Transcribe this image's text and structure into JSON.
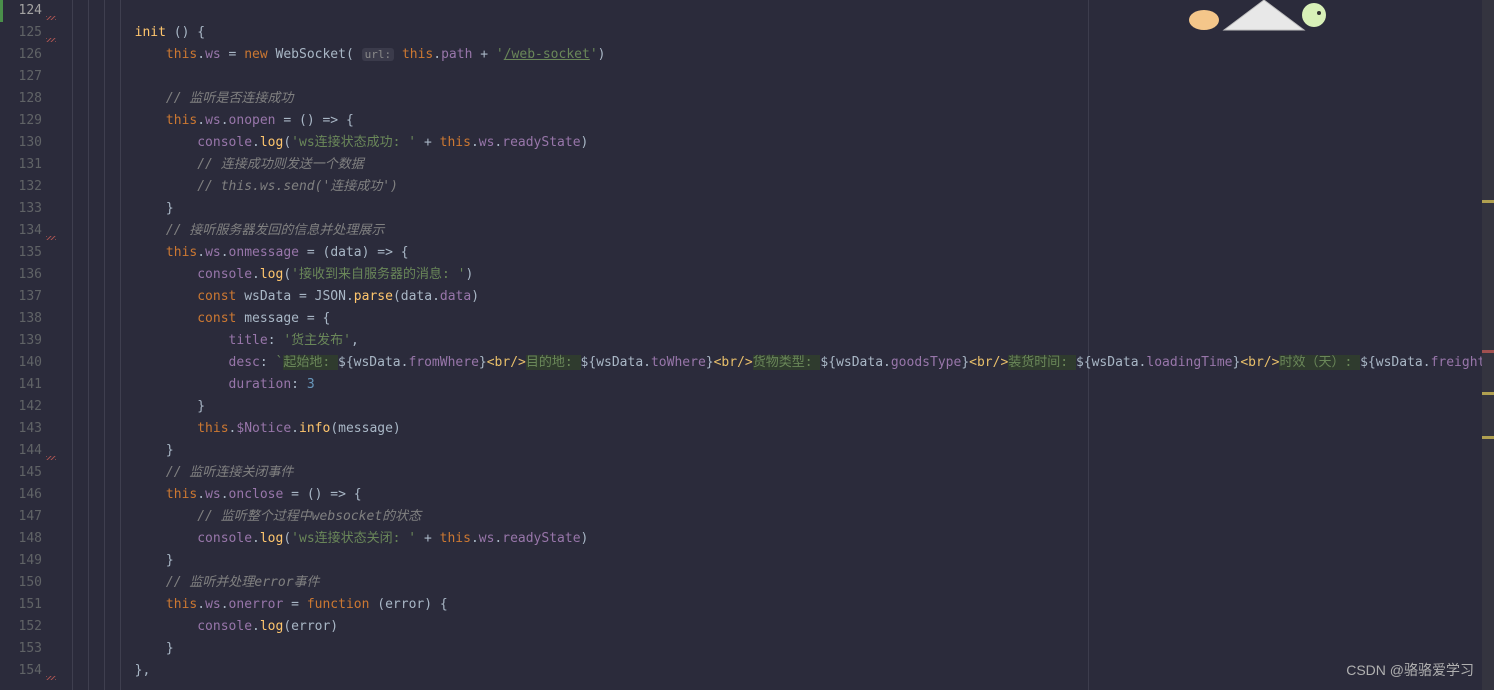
{
  "watermark": "CSDN @骆骆爱学习",
  "lines": [
    {
      "num": 124,
      "indent": 2,
      "tokens": []
    },
    {
      "num": 125,
      "indent": 2,
      "tokens": [
        {
          "t": "method",
          "v": "init"
        },
        {
          "t": "punc",
          "v": " () {"
        }
      ]
    },
    {
      "num": 126,
      "indent": 3,
      "tokens": [
        {
          "t": "keyword",
          "v": "this"
        },
        {
          "t": "punc",
          "v": "."
        },
        {
          "t": "prop",
          "v": "ws"
        },
        {
          "t": "punc",
          "v": " = "
        },
        {
          "t": "keyword",
          "v": "new"
        },
        {
          "t": "punc",
          "v": " "
        },
        {
          "t": "type",
          "v": "WebSocket"
        },
        {
          "t": "punc",
          "v": "( "
        },
        {
          "t": "hint",
          "v": "url:"
        },
        {
          "t": "punc",
          "v": " "
        },
        {
          "t": "keyword",
          "v": "this"
        },
        {
          "t": "punc",
          "v": "."
        },
        {
          "t": "prop",
          "v": "path"
        },
        {
          "t": "punc",
          "v": " + "
        },
        {
          "t": "string",
          "v": "'"
        },
        {
          "t": "stringlink",
          "v": "/web-socket"
        },
        {
          "t": "string",
          "v": "'"
        },
        {
          "t": "punc",
          "v": ")"
        }
      ]
    },
    {
      "num": 127,
      "indent": 3,
      "tokens": []
    },
    {
      "num": 128,
      "indent": 3,
      "tokens": [
        {
          "t": "comment",
          "v": "// 监听是否连接成功"
        }
      ]
    },
    {
      "num": 129,
      "indent": 3,
      "tokens": [
        {
          "t": "keyword",
          "v": "this"
        },
        {
          "t": "punc",
          "v": "."
        },
        {
          "t": "prop",
          "v": "ws"
        },
        {
          "t": "punc",
          "v": "."
        },
        {
          "t": "prop",
          "v": "onopen"
        },
        {
          "t": "punc",
          "v": " = () => {"
        }
      ]
    },
    {
      "num": 130,
      "indent": 4,
      "tokens": [
        {
          "t": "field",
          "v": "console"
        },
        {
          "t": "punc",
          "v": "."
        },
        {
          "t": "method",
          "v": "log"
        },
        {
          "t": "punc",
          "v": "("
        },
        {
          "t": "string",
          "v": "'ws连接状态成功: '"
        },
        {
          "t": "punc",
          "v": " + "
        },
        {
          "t": "keyword",
          "v": "this"
        },
        {
          "t": "punc",
          "v": "."
        },
        {
          "t": "prop",
          "v": "ws"
        },
        {
          "t": "punc",
          "v": "."
        },
        {
          "t": "prop",
          "v": "readyState"
        },
        {
          "t": "punc",
          "v": ")"
        }
      ]
    },
    {
      "num": 131,
      "indent": 4,
      "tokens": [
        {
          "t": "comment",
          "v": "// 连接成功则发送一个数据"
        }
      ]
    },
    {
      "num": 132,
      "indent": 4,
      "tokens": [
        {
          "t": "comment",
          "v": "// this.ws.send('连接成功')"
        }
      ]
    },
    {
      "num": 133,
      "indent": 3,
      "tokens": [
        {
          "t": "punc",
          "v": "}"
        }
      ]
    },
    {
      "num": 134,
      "indent": 3,
      "tokens": [
        {
          "t": "comment",
          "v": "// 接听服务器发回的信息并处理展示"
        }
      ]
    },
    {
      "num": 135,
      "indent": 3,
      "tokens": [
        {
          "t": "keyword",
          "v": "this"
        },
        {
          "t": "punc",
          "v": "."
        },
        {
          "t": "prop",
          "v": "ws"
        },
        {
          "t": "punc",
          "v": "."
        },
        {
          "t": "prop",
          "v": "onmessage"
        },
        {
          "t": "punc",
          "v": " = ("
        },
        {
          "t": "param",
          "v": "data"
        },
        {
          "t": "punc",
          "v": ") => {"
        }
      ]
    },
    {
      "num": 136,
      "indent": 4,
      "tokens": [
        {
          "t": "field",
          "v": "console"
        },
        {
          "t": "punc",
          "v": "."
        },
        {
          "t": "method",
          "v": "log"
        },
        {
          "t": "punc",
          "v": "("
        },
        {
          "t": "string",
          "v": "'接收到来自服务器的消息: '"
        },
        {
          "t": "punc",
          "v": ")"
        }
      ]
    },
    {
      "num": 137,
      "indent": 4,
      "tokens": [
        {
          "t": "keyword",
          "v": "const"
        },
        {
          "t": "punc",
          "v": " wsData = "
        },
        {
          "t": "type",
          "v": "JSON"
        },
        {
          "t": "punc",
          "v": "."
        },
        {
          "t": "method",
          "v": "parse"
        },
        {
          "t": "punc",
          "v": "(data."
        },
        {
          "t": "prop",
          "v": "data"
        },
        {
          "t": "punc",
          "v": ")"
        }
      ]
    },
    {
      "num": 138,
      "indent": 4,
      "tokens": [
        {
          "t": "keyword",
          "v": "const"
        },
        {
          "t": "punc",
          "v": " message = {"
        }
      ]
    },
    {
      "num": 139,
      "indent": 5,
      "tokens": [
        {
          "t": "prop",
          "v": "title"
        },
        {
          "t": "punc",
          "v": ": "
        },
        {
          "t": "string",
          "v": "'货主发布'"
        },
        {
          "t": "punc",
          "v": ","
        }
      ]
    },
    {
      "num": 140,
      "indent": 5,
      "desc": true
    },
    {
      "num": 141,
      "indent": 5,
      "tokens": [
        {
          "t": "prop",
          "v": "duration"
        },
        {
          "t": "punc",
          "v": ": "
        },
        {
          "t": "num",
          "v": "3"
        }
      ]
    },
    {
      "num": 142,
      "indent": 4,
      "tokens": [
        {
          "t": "punc",
          "v": "}"
        }
      ]
    },
    {
      "num": 143,
      "indent": 4,
      "tokens": [
        {
          "t": "keyword",
          "v": "this"
        },
        {
          "t": "punc",
          "v": "."
        },
        {
          "t": "prop",
          "v": "$Notice"
        },
        {
          "t": "punc",
          "v": "."
        },
        {
          "t": "method",
          "v": "info"
        },
        {
          "t": "punc",
          "v": "(message)"
        }
      ]
    },
    {
      "num": 144,
      "indent": 3,
      "tokens": [
        {
          "t": "punc",
          "v": "}"
        }
      ]
    },
    {
      "num": 145,
      "indent": 3,
      "tokens": [
        {
          "t": "comment",
          "v": "// 监听连接关闭事件"
        }
      ]
    },
    {
      "num": 146,
      "indent": 3,
      "tokens": [
        {
          "t": "keyword",
          "v": "this"
        },
        {
          "t": "punc",
          "v": "."
        },
        {
          "t": "prop",
          "v": "ws"
        },
        {
          "t": "punc",
          "v": "."
        },
        {
          "t": "prop",
          "v": "onclose"
        },
        {
          "t": "punc",
          "v": " = () => {"
        }
      ]
    },
    {
      "num": 147,
      "indent": 4,
      "tokens": [
        {
          "t": "comment",
          "v": "// 监听整个过程中websocket的状态"
        }
      ]
    },
    {
      "num": 148,
      "indent": 4,
      "tokens": [
        {
          "t": "field",
          "v": "console"
        },
        {
          "t": "punc",
          "v": "."
        },
        {
          "t": "method",
          "v": "log"
        },
        {
          "t": "punc",
          "v": "("
        },
        {
          "t": "string",
          "v": "'ws连接状态关闭: '"
        },
        {
          "t": "punc",
          "v": " + "
        },
        {
          "t": "keyword",
          "v": "this"
        },
        {
          "t": "punc",
          "v": "."
        },
        {
          "t": "prop",
          "v": "ws"
        },
        {
          "t": "punc",
          "v": "."
        },
        {
          "t": "prop",
          "v": "readyState"
        },
        {
          "t": "punc",
          "v": ")"
        }
      ]
    },
    {
      "num": 149,
      "indent": 3,
      "tokens": [
        {
          "t": "punc",
          "v": "}"
        }
      ]
    },
    {
      "num": 150,
      "indent": 3,
      "tokens": [
        {
          "t": "comment",
          "v": "// 监听并处理error事件"
        }
      ]
    },
    {
      "num": 151,
      "indent": 3,
      "tokens": [
        {
          "t": "keyword",
          "v": "this"
        },
        {
          "t": "punc",
          "v": "."
        },
        {
          "t": "prop",
          "v": "ws"
        },
        {
          "t": "punc",
          "v": "."
        },
        {
          "t": "prop",
          "v": "onerror"
        },
        {
          "t": "punc",
          "v": " = "
        },
        {
          "t": "keyword",
          "v": "function"
        },
        {
          "t": "punc",
          "v": " ("
        },
        {
          "t": "param",
          "v": "error"
        },
        {
          "t": "punc",
          "v": ") {"
        }
      ]
    },
    {
      "num": 152,
      "indent": 4,
      "tokens": [
        {
          "t": "field",
          "v": "console"
        },
        {
          "t": "punc",
          "v": "."
        },
        {
          "t": "method",
          "v": "log"
        },
        {
          "t": "punc",
          "v": "(error)"
        }
      ]
    },
    {
      "num": 153,
      "indent": 3,
      "tokens": [
        {
          "t": "punc",
          "v": "}"
        }
      ]
    },
    {
      "num": 154,
      "indent": 2,
      "tokens": [
        {
          "t": "punc",
          "v": "},"
        }
      ]
    }
  ],
  "desc_line": {
    "prefix_prop": "desc",
    "segments": [
      {
        "label": "起始地: ",
        "expr": "wsData.fromWhere",
        "field": "fromWhere"
      },
      {
        "label": "目的地: ",
        "expr": "wsData.toWhere",
        "field": "toWhere"
      },
      {
        "label": "货物类型: ",
        "expr": "wsData.goodsType",
        "field": "goodsType"
      },
      {
        "label": "装货时间: ",
        "expr": "wsData.loadingTime",
        "field": "loadingTime"
      },
      {
        "label": "时效（天）: ",
        "expr": "wsData.freightTerm",
        "field": "freightTerm"
      }
    ],
    "br": "<br/>"
  },
  "squiggle_lines": [
    124,
    125,
    134,
    144,
    154
  ]
}
